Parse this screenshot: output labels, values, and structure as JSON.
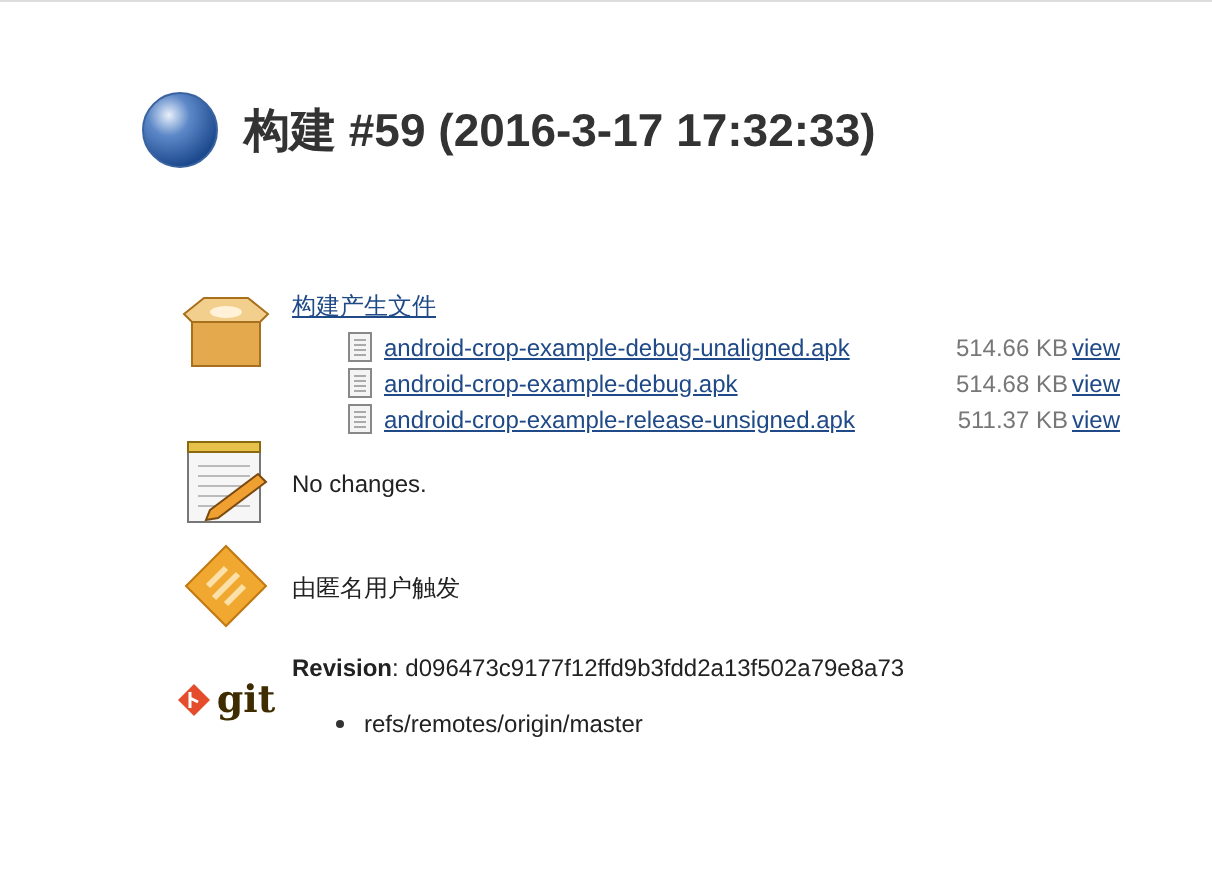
{
  "heading": {
    "title": "构建 #59 (2016-3-17 17:32:33)"
  },
  "artifacts": {
    "link": "构建产生文件",
    "files": [
      {
        "name": "android-crop-example-debug-unaligned.apk",
        "size": "514.66 KB",
        "action": "view"
      },
      {
        "name": "android-crop-example-debug.apk",
        "size": "514.68 KB",
        "action": "view"
      },
      {
        "name": "android-crop-example-release-unsigned.apk",
        "size": "511.37 KB",
        "action": "view"
      }
    ]
  },
  "changes": {
    "text": "No changes."
  },
  "cause": {
    "text": "由匿名用户触发"
  },
  "git": {
    "logo_text": "git",
    "revision": "**Revision**: d096473c9177f12ffd9b3fdd2a13f502a79e8a73",
    "branches": [
      "refs/remotes/origin/master"
    ]
  }
}
